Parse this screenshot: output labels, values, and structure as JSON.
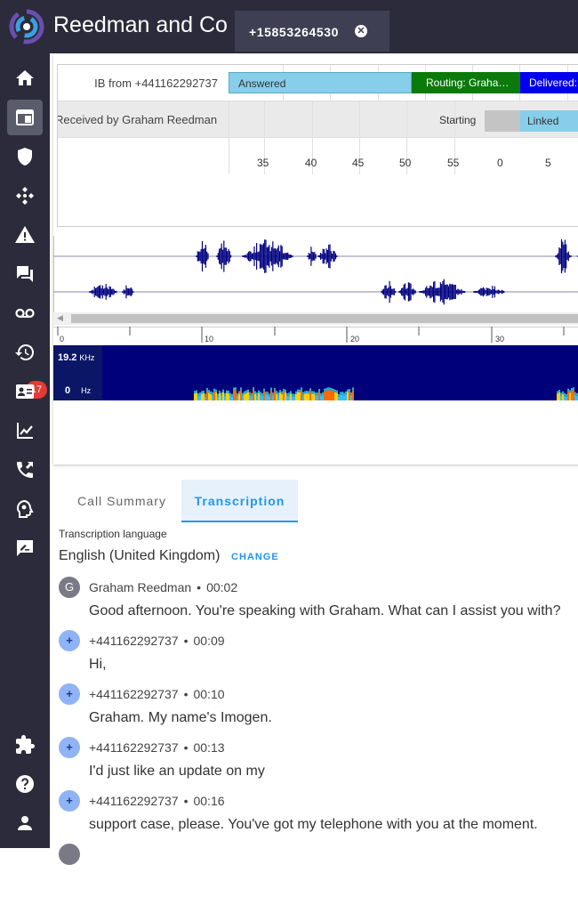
{
  "app": {
    "title": "Reedman and Co"
  },
  "tab": {
    "label": "+15853264530",
    "close_glyph": "✕"
  },
  "sidebar": {
    "items": [
      {
        "name": "home-icon"
      },
      {
        "name": "window-icon",
        "active": true
      },
      {
        "name": "shield-icon"
      },
      {
        "name": "hub-icon"
      },
      {
        "name": "warning-icon"
      },
      {
        "name": "chat-icon"
      },
      {
        "name": "voicemail-icon"
      },
      {
        "name": "history-icon",
        "badge": "17"
      },
      {
        "name": "contact-card-icon"
      },
      {
        "name": "analytics-icon"
      },
      {
        "name": "phone-forward-icon"
      },
      {
        "name": "brain-icon"
      },
      {
        "name": "feedback-icon"
      },
      {
        "name": "extension-icon"
      },
      {
        "name": "help-icon"
      },
      {
        "name": "person-icon"
      }
    ]
  },
  "timeline": {
    "row1": {
      "label": "IB from +441162292737",
      "segments": [
        {
          "text": "Answered",
          "color": "#87ceeb",
          "text_color": "#333333"
        },
        {
          "text": "Routing: Graha…",
          "color": "#0a7a0a",
          "text_color": "#ffffff"
        },
        {
          "text": "Delivered:",
          "color": "#0000ee",
          "text_color": "#ffffff"
        }
      ]
    },
    "row2": {
      "label": "Received by Graham Reedman",
      "status_text": "Starting",
      "segments": [
        {
          "text": "",
          "color": "#c4c4c4",
          "text_color": "#333333"
        },
        {
          "text": "Linked",
          "color": "#87ceeb",
          "text_color": "#333333"
        }
      ]
    },
    "ticks": [
      "35",
      "40",
      "45",
      "50",
      "55",
      "0",
      "5"
    ]
  },
  "ruler": {
    "labels": [
      "0",
      "10",
      "20",
      "30"
    ]
  },
  "spectrogram": {
    "top_value": "19.2",
    "top_unit": "KHz",
    "bottom_value": "0",
    "bottom_unit": "Hz"
  },
  "details_tabs": {
    "summary": "Call Summary",
    "transcription": "Transcription"
  },
  "transcription": {
    "language_caption": "Transcription language",
    "language_value": "English (United Kingdom)",
    "change_label": "CHANGE",
    "entries": [
      {
        "avatar": "G",
        "speaker": "Graham Reedman",
        "time": "00:02",
        "text": "Good afternoon. You're speaking with Graham. What can I assist you with?"
      },
      {
        "avatar": "+",
        "speaker": "+441162292737",
        "time": "00:09",
        "text": "Hi,"
      },
      {
        "avatar": "+",
        "speaker": "+441162292737",
        "time": "00:10",
        "text": "Graham. My name's Imogen."
      },
      {
        "avatar": "+",
        "speaker": "+441162292737",
        "time": "00:13",
        "text": "I'd just like an update on my"
      },
      {
        "avatar": "+",
        "speaker": "+441162292737",
        "time": "00:16",
        "text": "support case, please. You've got my telephone with you at the moment."
      }
    ]
  },
  "colors": {
    "sidebar_bg": "#2b2b3b",
    "accent": "#2196f3",
    "badge": "#e53935",
    "waveform": "#000080"
  }
}
